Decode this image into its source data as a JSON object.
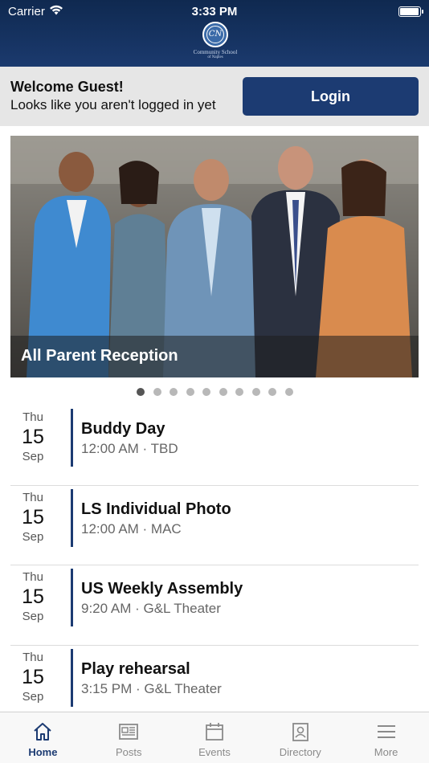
{
  "status_bar": {
    "carrier": "Carrier",
    "time": "3:33 PM",
    "battery_level": 1.0
  },
  "header": {
    "logo_initials": "CN",
    "logo_text": "Community School",
    "logo_subtext": "of Naples"
  },
  "welcome": {
    "title": "Welcome Guest!",
    "subtitle": "Looks like you aren't logged in yet",
    "login_label": "Login"
  },
  "hero": {
    "caption": "All Parent Reception",
    "page_count": 10,
    "active_page": 1
  },
  "events": [
    {
      "dow": "Thu",
      "day": "15",
      "month": "Sep",
      "title": "Buddy Day",
      "meta": "12:00 AM · TBD"
    },
    {
      "dow": "Thu",
      "day": "15",
      "month": "Sep",
      "title": "LS Individual Photo",
      "meta": "12:00 AM · MAC"
    },
    {
      "dow": "Thu",
      "day": "15",
      "month": "Sep",
      "title": "US Weekly Assembly",
      "meta": "9:20 AM · G&L Theater"
    },
    {
      "dow": "Thu",
      "day": "15",
      "month": "Sep",
      "title": "Play rehearsal",
      "meta": "3:15 PM · G&L Theater"
    }
  ],
  "tabs": [
    {
      "label": "Home",
      "icon": "home-icon",
      "active": true
    },
    {
      "label": "Posts",
      "icon": "newspaper-icon",
      "active": false
    },
    {
      "label": "Events",
      "icon": "calendar-icon",
      "active": false
    },
    {
      "label": "Directory",
      "icon": "contact-card-icon",
      "active": false
    },
    {
      "label": "More",
      "icon": "hamburger-menu-icon",
      "active": false
    }
  ],
  "colors": {
    "brand_navy": "#1c3b72",
    "header_dark": "#0f2950",
    "welcome_bg": "#e6e6e6"
  }
}
